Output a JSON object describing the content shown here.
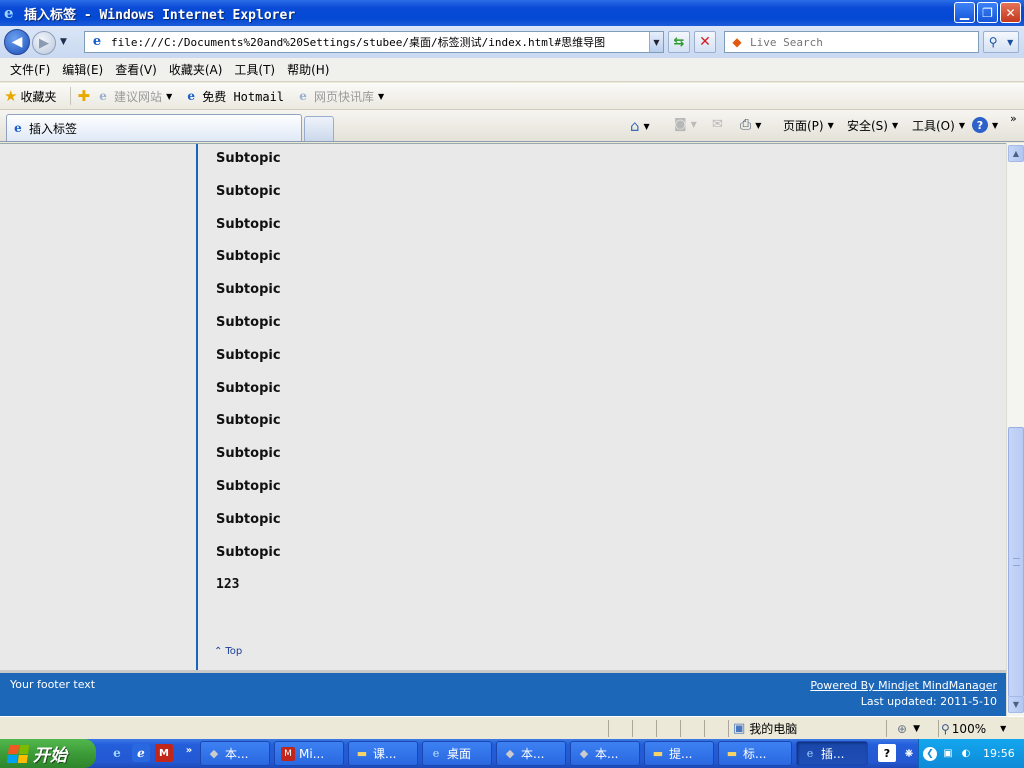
{
  "window": {
    "title": "插入标签 - Windows Internet Explorer"
  },
  "address": {
    "url": "file:///C:/Documents%20and%20Settings/stubee/桌面/标签测试/index.html#思维导图",
    "search_placeholder": "Live Search"
  },
  "menu": [
    "文件(F)",
    "编辑(E)",
    "查看(V)",
    "收藏夹(A)",
    "工具(T)",
    "帮助(H)"
  ],
  "favorites": {
    "label": "收藏夹",
    "items": [
      "建议网站",
      "免费 Hotmail",
      "网页快讯库"
    ]
  },
  "tabs": {
    "active": "插入标签"
  },
  "commands": {
    "page": "页面(P)",
    "safety": "安全(S)",
    "tools": "工具(O)"
  },
  "page": {
    "topics": [
      "Subtopic",
      "Subtopic",
      "Subtopic",
      "Subtopic",
      "Subtopic",
      "Subtopic",
      "Subtopic",
      "Subtopic",
      "Subtopic",
      "Subtopic",
      "Subtopic",
      "Subtopic",
      "Subtopic",
      "123"
    ],
    "top_link": "Top",
    "footer_text": "Your footer text",
    "powered_by": "Powered By Mindjet MindManager",
    "last_updated": "Last updated: 2011-5-10"
  },
  "status": {
    "zone": "我的电脑",
    "zoom": "100%"
  },
  "taskbar": {
    "start": "开始",
    "buttons": [
      "本...",
      "Mi...",
      "课...",
      "桌面",
      "本...",
      "本...",
      "提...",
      "标...",
      "插..."
    ],
    "clock": "19:56"
  },
  "colors": {
    "footer_bg": "#1d67b8",
    "divider": "#1565b8",
    "content_bg": "#e9e9e9"
  }
}
